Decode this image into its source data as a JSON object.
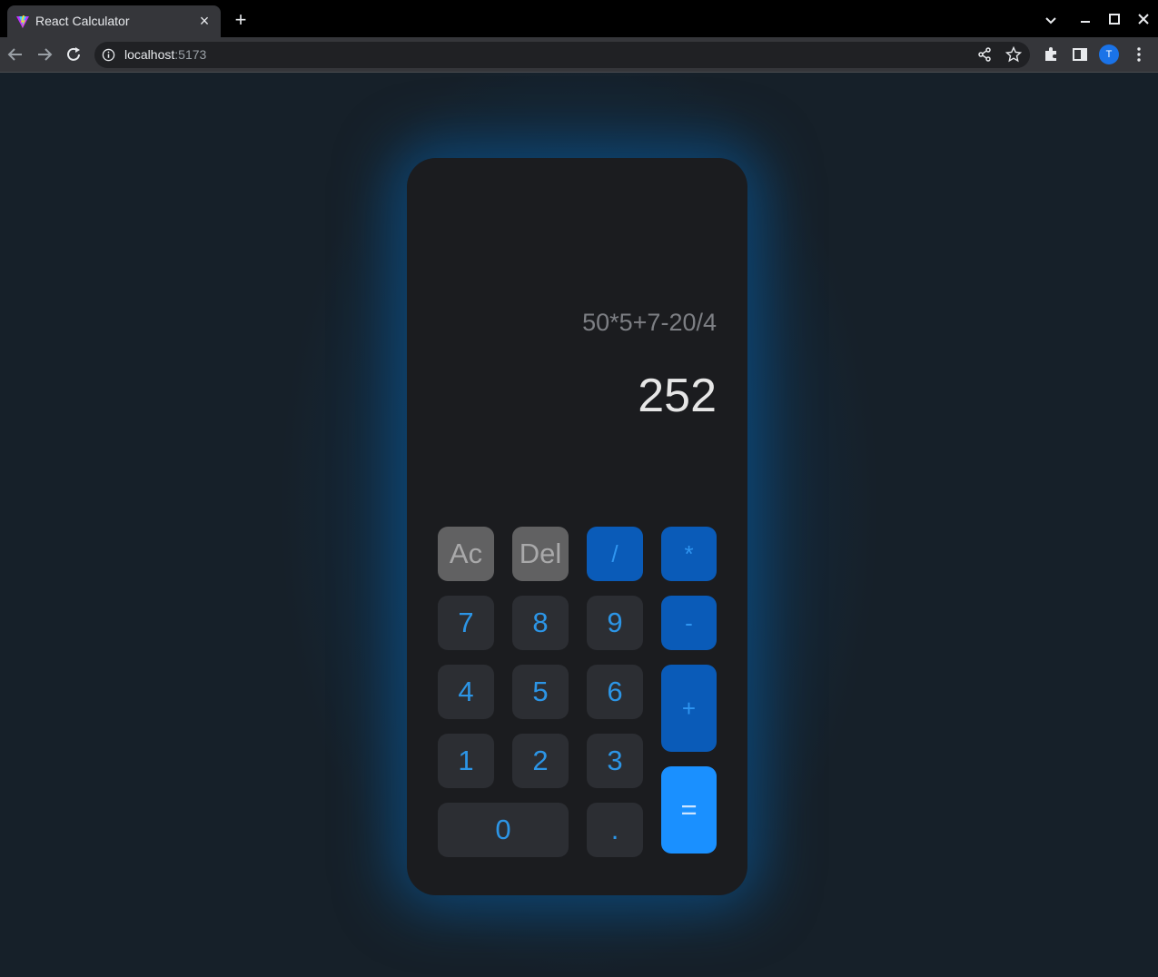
{
  "browser": {
    "tab_title": "React Calculator",
    "url_host": "localhost",
    "url_port": ":5173",
    "profile_initial": "T"
  },
  "calculator": {
    "expression": "50*5+7-20/4",
    "result": "252",
    "keys": {
      "ac": "Ac",
      "del": "Del",
      "divide": "/",
      "multiply": "*",
      "seven": "7",
      "eight": "8",
      "nine": "9",
      "minus": "-",
      "four": "4",
      "five": "5",
      "six": "6",
      "plus": "+",
      "one": "1",
      "two": "2",
      "three": "3",
      "equals": "=",
      "zero": "0",
      "dot": "."
    }
  },
  "colors": {
    "page_background": "#162029",
    "panel": "#1b1c1f",
    "number_key": "#2c2e33",
    "function_key": "#616162",
    "operator_key": "#0a5bb8",
    "equals_key": "#1a90ff",
    "key_text_accent": "#2c95e6"
  }
}
